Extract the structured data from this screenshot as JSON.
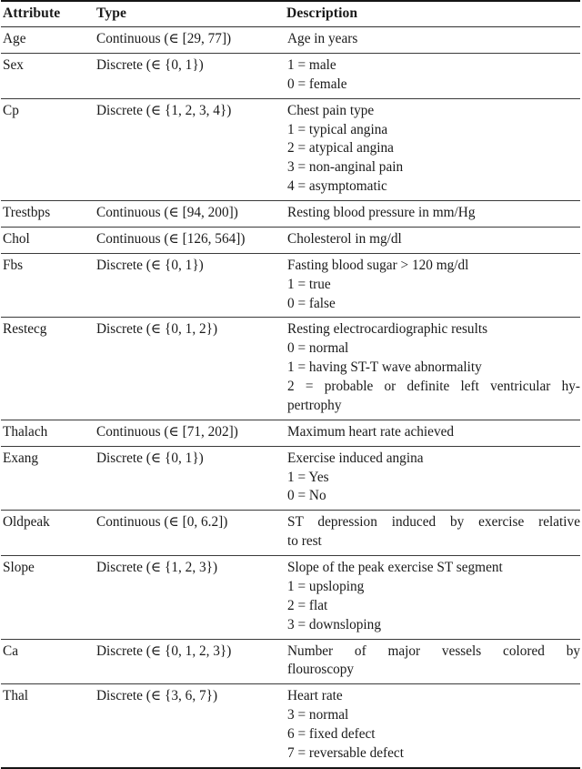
{
  "table": {
    "columns": [
      "Attribute",
      "Type",
      "Description"
    ],
    "rows": [
      {
        "attribute": "Age",
        "type": "Continuous (∈ [29, 77])",
        "description": [
          "Age in years"
        ]
      },
      {
        "attribute": "Sex",
        "type": "Discrete (∈ {0, 1})",
        "description": [
          "1 = male",
          "0 = female"
        ]
      },
      {
        "attribute": "Cp",
        "type": "Discrete (∈ {1, 2, 3, 4})",
        "description": [
          "Chest pain type",
          "1 = typical angina",
          "2 = atypical angina",
          "3 = non-anginal pain",
          "4 = asymptomatic"
        ]
      },
      {
        "attribute": "Trestbps",
        "type": "Continuous (∈ [94, 200])",
        "description": [
          "Resting blood pressure in mm/Hg"
        ]
      },
      {
        "attribute": "Chol",
        "type": "Continuous (∈ [126, 564])",
        "description": [
          "Cholesterol in mg/dl"
        ]
      },
      {
        "attribute": "Fbs",
        "type": "Discrete (∈ {0, 1})",
        "description": [
          "Fasting blood sugar > 120 mg/dl",
          "1 = true",
          "0 = false"
        ]
      },
      {
        "attribute": "Restecg",
        "type": "Discrete (∈ {0, 1, 2})",
        "description": [
          "Resting electrocardiographic results",
          "0 = normal",
          "1 = having ST-T wave abnormality",
          "2 = probable or definite left ventricular hy-",
          "pertrophy"
        ]
      },
      {
        "attribute": "Thalach",
        "type": "Continuous (∈ [71, 202])",
        "description": [
          "Maximum heart rate achieved"
        ]
      },
      {
        "attribute": "Exang",
        "type": "Discrete (∈ {0, 1})",
        "description": [
          "Exercise induced angina",
          "1 = Yes",
          "0 = No"
        ]
      },
      {
        "attribute": "Oldpeak",
        "type": "Continuous (∈ [0, 6.2])",
        "description": [
          "ST depression induced by exercise relative",
          "to rest"
        ]
      },
      {
        "attribute": "Slope",
        "type": "Discrete (∈ {1, 2, 3})",
        "description": [
          "Slope of the peak exercise ST segment",
          "1 = upsloping",
          "2 = flat",
          "3 = downsloping"
        ]
      },
      {
        "attribute": "Ca",
        "type": "Discrete (∈ {0, 1, 2, 3})",
        "description": [
          "Number of major vessels colored by",
          "flouroscopy"
        ]
      },
      {
        "attribute": "Thal",
        "type": "Discrete (∈ {3, 6, 7})",
        "description": [
          "Heart rate",
          "3 = normal",
          "6 = fixed defect",
          "7 = reversable defect"
        ]
      }
    ]
  }
}
